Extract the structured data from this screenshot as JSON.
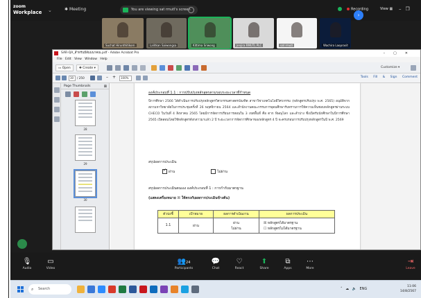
{
  "zoom": {
    "logo_line1": "zoom",
    "logo_line2": "Workplace",
    "meeting_label": "Meeting",
    "share_text": "You are viewing sat rmutl's screen",
    "recording_label": "Recording",
    "view_label": "View",
    "participants": [
      {
        "name": "Suchat Hirunthitikorn",
        "bg": "#8a7b63"
      },
      {
        "name": "Lalitkan Saiwongsa",
        "bg": "#6f6a5e"
      },
      {
        "name": "Kittima Sriwong",
        "bg": "#4f8f5a"
      },
      {
        "name": "Jenjira RMUTL PLC",
        "bg": "#d9d9d9"
      },
      {
        "name": "sat rmutl",
        "bg": "#f5f5f5"
      },
      {
        "name": "Wachira Laoprasit",
        "bg": "#0b1c3a"
      }
    ],
    "bottom": {
      "audio": "Audio",
      "video": "Video",
      "participants": "Participants",
      "participants_count": "24",
      "chat": "Chat",
      "react": "React",
      "share": "Share",
      "apps": "Apps",
      "more": "More",
      "leave": "Leave"
    }
  },
  "acrobat": {
    "title": "SAR-QA_สำหรับมีสัมมนาคณ.pdf - Adobe Acrobat Pro",
    "menu": "File  Edit  View  Window  Help",
    "open_label": "Open",
    "create_label": "Create",
    "customize_label": "Customize",
    "page_current": "30",
    "page_total": "/ 250",
    "zoom_value": "100%",
    "tools_label": "Tools",
    "fill_sign_label": "Fill & Sign",
    "comment_label": "Comment",
    "thumbs_title": "Page Thumbnails",
    "thumb_labels": [
      "28",
      "29",
      "30"
    ]
  },
  "document": {
    "heading": "องค์ประกอบที่ 1.1 : การปรับปรุงหลักสูตรตามรอบระยะเวลาที่กำหนด",
    "para": "ปีการศึกษา 2566 ได้ดำเนินการปรับปรุงหลักสูตรวิศวกรรมศาสตรบัณฑิต สาขาวิชาเทคโนโลยีวิศวกรรม (หลักสูตรปรับปรุง พ.ศ. 2565) อนุมัติจากสภามหาวิทยาลัยในการประชุมครั้งที่ 26 พฤศจิกายน 2564 และสำนักงานคณะกรรมการอุดมศึกษารับทราบการให้ความเห็นชอบหลักสูตรผ่านระบบ CHECO ในวันที่ 4 สิงหาคม 2565 โดยมีการจัดการเรียนการสอนใน 3 เขตพื้นที่ คือ ตาก พิษณุโลก และลำปาง ซึ่งเปิดรับนักศึกษาในปีการศึกษา 2565 เปิดสอนโดยใช้หลักสูตรดังกล่าวมาแล้ว 2 ปี ระยะเวลาการจัดการศึกษาของหลักสูตร 4 ปี จะครบรอบการปรับปรุงหลักสูตรในปี พ.ศ. 2569",
    "summary_label": "สรุปผลการประเมิน",
    "pass_label": "ผ่าน",
    "fail_label": "ไม่ผ่าน",
    "summary2_label": "สรุปผลการประเมินตนเอง องค์ประกอบที่ 1 : การกำกับมาตรฐาน",
    "legend_label": "(แสดงเครื่องหมาย ☒ ให้ตรงกับผลการประเมินข้างต้น)",
    "table": {
      "headers": [
        "ตัวบ่งชี้",
        "เป้าหมาย",
        "ผลการดำเนินงาน",
        "ผลการประเมิน"
      ],
      "row": {
        "id": "1.1",
        "target": "ผ่าน",
        "result_line1": "ผ่าน",
        "result_line2": "ไม่ผ่าน",
        "assess_line1": "☒ หลักสูตรได้มาตรฐาน",
        "assess_line2": "☐ หลักสูตรไม่ได้มาตรฐาน"
      }
    }
  },
  "taskbar": {
    "search_placeholder": "Search",
    "tray": "ENG",
    "time": "11:06",
    "date": "14/8/2567"
  },
  "colors": {
    "zoom_bg": "#1a1a1a",
    "accent_green": "#1bb45a",
    "table_header": "#ffff99",
    "link_blue": "#1b4f9c"
  }
}
